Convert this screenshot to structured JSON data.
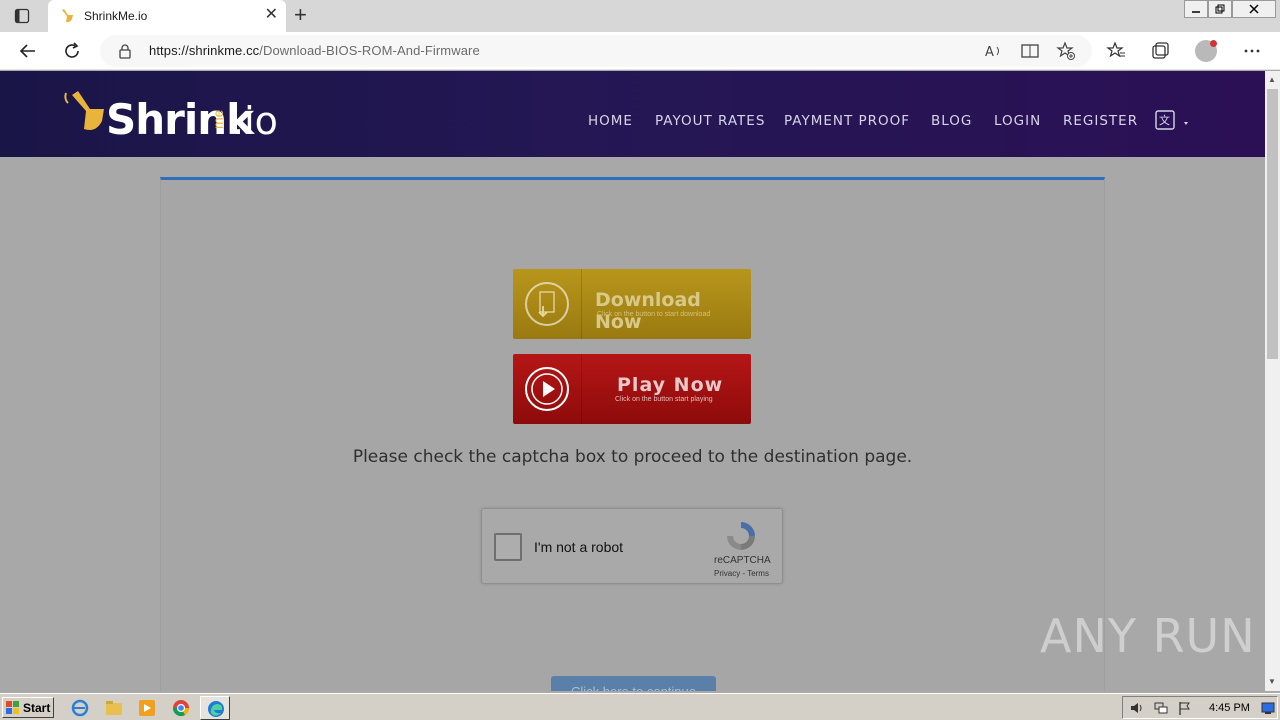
{
  "browser": {
    "tab_title": "ShrinkMe.io",
    "url_host": "https://shrinkme.cc",
    "url_path": "/Download-BIOS-ROM-And-Firmware"
  },
  "site": {
    "logo": {
      "main": "Shrink",
      "me": "me",
      "io": ".io"
    },
    "nav": [
      {
        "label": "HOME"
      },
      {
        "label": "PAYOUT RATES"
      },
      {
        "label": "PAYMENT PROOF"
      },
      {
        "label": "BLOG"
      },
      {
        "label": "LOGIN"
      },
      {
        "label": "REGISTER"
      }
    ]
  },
  "content": {
    "download_btn": {
      "title": "Download Now",
      "subtitle": "Click on the button to start download"
    },
    "play_btn": {
      "title": "Play Now",
      "subtitle": "Click on the button start playing"
    },
    "captcha_message": "Please check the captcha box to proceed to the destination page.",
    "recaptcha": {
      "label": "I'm not a robot",
      "brand": "reCAPTCHA",
      "links": "Privacy - Terms"
    },
    "continue_label": "Click here to continue"
  },
  "watermark": "ANY RUN",
  "taskbar": {
    "start_label": "Start",
    "clock": "4:45 PM"
  },
  "colors": {
    "nav_bg": "#241754",
    "accent_blue": "#2d6fbd",
    "download_gold": "#b8961c",
    "play_red": "#b51616",
    "logo_gold": "#e8b43a"
  }
}
